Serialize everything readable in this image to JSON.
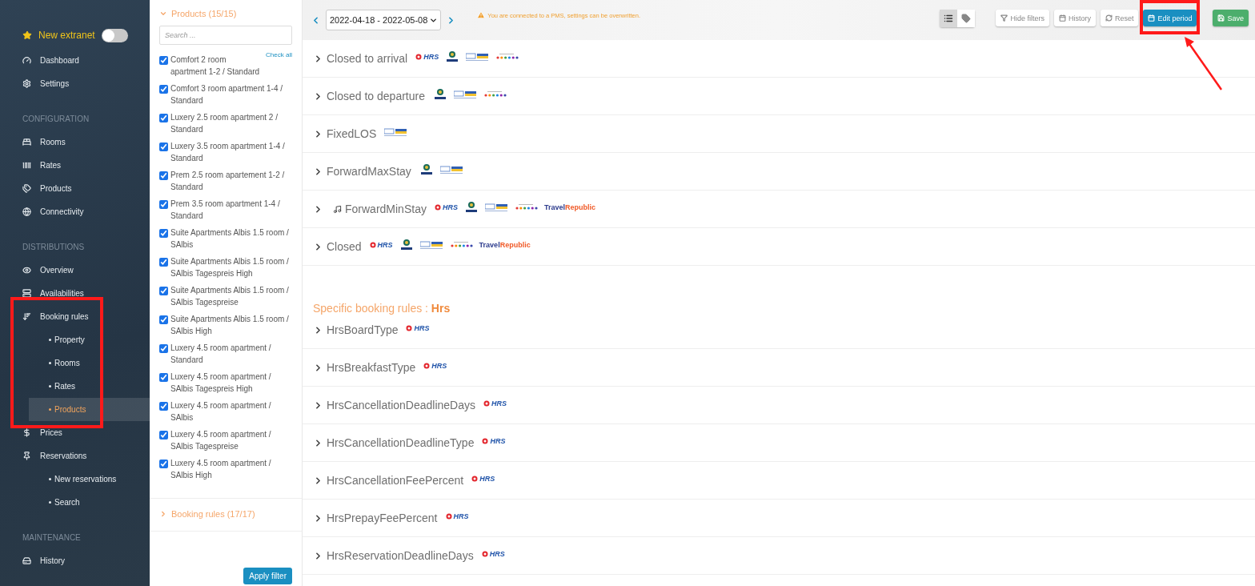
{
  "sidebar": {
    "toggle": {
      "label": "New extranet",
      "on": false
    },
    "sections": [
      {
        "items": [
          {
            "label": "Dashboard",
            "selected": false
          },
          {
            "label": "Settings",
            "selected": false
          }
        ]
      },
      {
        "heading": "CONFIGURATION",
        "items": [
          {
            "label": "Rooms",
            "selected": false
          },
          {
            "label": "Rates",
            "selected": false
          },
          {
            "label": "Products",
            "selected": false
          },
          {
            "label": "Connectivity",
            "selected": false
          }
        ]
      },
      {
        "heading": "DISTRIBUTIONS",
        "items": [
          {
            "label": "Overview",
            "selected": false
          },
          {
            "label": "Availabilities",
            "selected": false
          },
          {
            "label": "Booking rules",
            "selected": false,
            "highlighted": true,
            "children": [
              {
                "label": "Property",
                "selected": false
              },
              {
                "label": "Rooms",
                "selected": false
              },
              {
                "label": "Rates",
                "selected": false
              },
              {
                "label": "Products",
                "selected": true
              }
            ]
          },
          {
            "label": "Prices",
            "selected": false
          },
          {
            "label": "Reservations",
            "selected": false,
            "children": [
              {
                "label": "New reservations",
                "selected": false
              },
              {
                "label": "Search",
                "selected": false
              }
            ]
          }
        ]
      },
      {
        "heading": "MAINTENANCE",
        "items": [
          {
            "label": "History",
            "selected": false
          }
        ]
      }
    ]
  },
  "filters": {
    "products_header": {
      "label": "Products (15/15)",
      "expanded": true
    },
    "search": {
      "placeholder": "Search ..."
    },
    "check_all": "Check all",
    "products": [
      {
        "label": "Comfort 2 room apartment 1-2 / Standard",
        "checked": true
      },
      {
        "label": "Comfort 3 room apartment 1-4 / Standard",
        "checked": true
      },
      {
        "label": "Luxery 2.5 room apartment 2 / Standard",
        "checked": true
      },
      {
        "label": "Luxery 3.5 room apartment 1-4 / Standard",
        "checked": true
      },
      {
        "label": "Prem 2.5 room apartement 1-2 / Standard",
        "checked": true
      },
      {
        "label": "Prem 3.5 room apartment 1-4 / Standard",
        "checked": true
      },
      {
        "label": "Suite Apartments Albis 1.5 room / SAlbis",
        "checked": true
      },
      {
        "label": "Suite Apartments Albis 1.5 room / SAlbis Tagespreis High",
        "checked": true
      },
      {
        "label": "Suite Apartments Albis 1.5 room / SAlbis Tagespreise",
        "checked": true
      },
      {
        "label": "Suite Apartments Albis 1.5 room / SAlbis High",
        "checked": true
      },
      {
        "label": "Luxery 4.5 room apartment / Standard",
        "checked": true
      },
      {
        "label": "Luxery 4.5 room apartment / SAlbis Tagespreis High",
        "checked": true
      },
      {
        "label": "Luxery 4.5 room apartment / SAlbis",
        "checked": true
      },
      {
        "label": "Luxery 4.5 room apartment / SAlbis Tagespreise",
        "checked": true
      },
      {
        "label": "Luxery 4.5 room apartment / SAlbis High",
        "checked": true
      }
    ],
    "booking_rules_header": {
      "label": "Booking rules (17/17)",
      "expanded": false
    },
    "apply_button": "Apply filter"
  },
  "toolbar": {
    "period": "2022-04-18 - 2022-05-08",
    "warning": "You are connected to a PMS, settings can be overwritten.",
    "view_toggle": [
      {
        "selected": true
      },
      {
        "selected": false
      }
    ],
    "buttons": [
      {
        "label": "Hide filters",
        "kind": "filter",
        "highlighted": false
      },
      {
        "label": "History",
        "kind": "history",
        "highlighted": false
      },
      {
        "label": "Reset",
        "kind": "reset",
        "highlighted": false
      },
      {
        "label": "Edit period",
        "kind": "edit",
        "highlighted": true
      },
      {
        "label": "Save",
        "kind": "save",
        "highlighted": false
      }
    ]
  },
  "rules": [
    {
      "label": "Closed to arrival",
      "marked": false,
      "channels": [
        {
          "kind": "hrs",
          "text": "HRS"
        },
        {
          "kind": "expedia"
        },
        {
          "kind": "fewo"
        },
        {
          "kind": "dots"
        }
      ]
    },
    {
      "label": "Closed to departure",
      "marked": false,
      "channels": [
        {
          "kind": "expedia"
        },
        {
          "kind": "fewo"
        },
        {
          "kind": "dots"
        }
      ]
    },
    {
      "label": "FixedLOS",
      "marked": false,
      "channels": [
        {
          "kind": "fewo"
        }
      ]
    },
    {
      "label": "ForwardMaxStay",
      "marked": false,
      "channels": [
        {
          "kind": "expedia"
        },
        {
          "kind": "fewo"
        }
      ]
    },
    {
      "label": "ForwardMinStay",
      "marked": true,
      "channels": [
        {
          "kind": "hrs",
          "text": "HRS"
        },
        {
          "kind": "expedia"
        },
        {
          "kind": "fewo"
        },
        {
          "kind": "dots"
        },
        {
          "kind": "travelrepublic",
          "parts": [
            "Travel",
            "Republic"
          ]
        }
      ]
    },
    {
      "label": "Closed",
      "marked": false,
      "channels": [
        {
          "kind": "hrs",
          "text": "HRS"
        },
        {
          "kind": "expedia"
        },
        {
          "kind": "fewo"
        },
        {
          "kind": "dots"
        },
        {
          "kind": "travelrepublic",
          "parts": [
            "Travel",
            "Republic"
          ]
        }
      ]
    }
  ],
  "specific": {
    "heading": "Specific booking rules : **Hrs**",
    "rules": [
      {
        "label": "HrsBoardType",
        "marked": false,
        "channels": [
          {
            "kind": "hrs",
            "text": "HRS"
          }
        ]
      },
      {
        "label": "HrsBreakfastType",
        "marked": false,
        "channels": [
          {
            "kind": "hrs",
            "text": "HRS"
          }
        ]
      },
      {
        "label": "HrsCancellationDeadlineDays",
        "marked": false,
        "channels": [
          {
            "kind": "hrs",
            "text": "HRS"
          }
        ]
      },
      {
        "label": "HrsCancellationDeadlineType",
        "marked": false,
        "channels": [
          {
            "kind": "hrs",
            "text": "HRS"
          }
        ]
      },
      {
        "label": "HrsCancellationFeePercent",
        "marked": false,
        "channels": [
          {
            "kind": "hrs",
            "text": "HRS"
          }
        ]
      },
      {
        "label": "HrsPrepayFeePercent",
        "marked": false,
        "channels": [
          {
            "kind": "hrs",
            "text": "HRS"
          }
        ]
      },
      {
        "label": "HrsReservationDeadlineDays",
        "marked": false,
        "channels": [
          {
            "kind": "hrs",
            "text": "HRS"
          }
        ]
      }
    ]
  }
}
